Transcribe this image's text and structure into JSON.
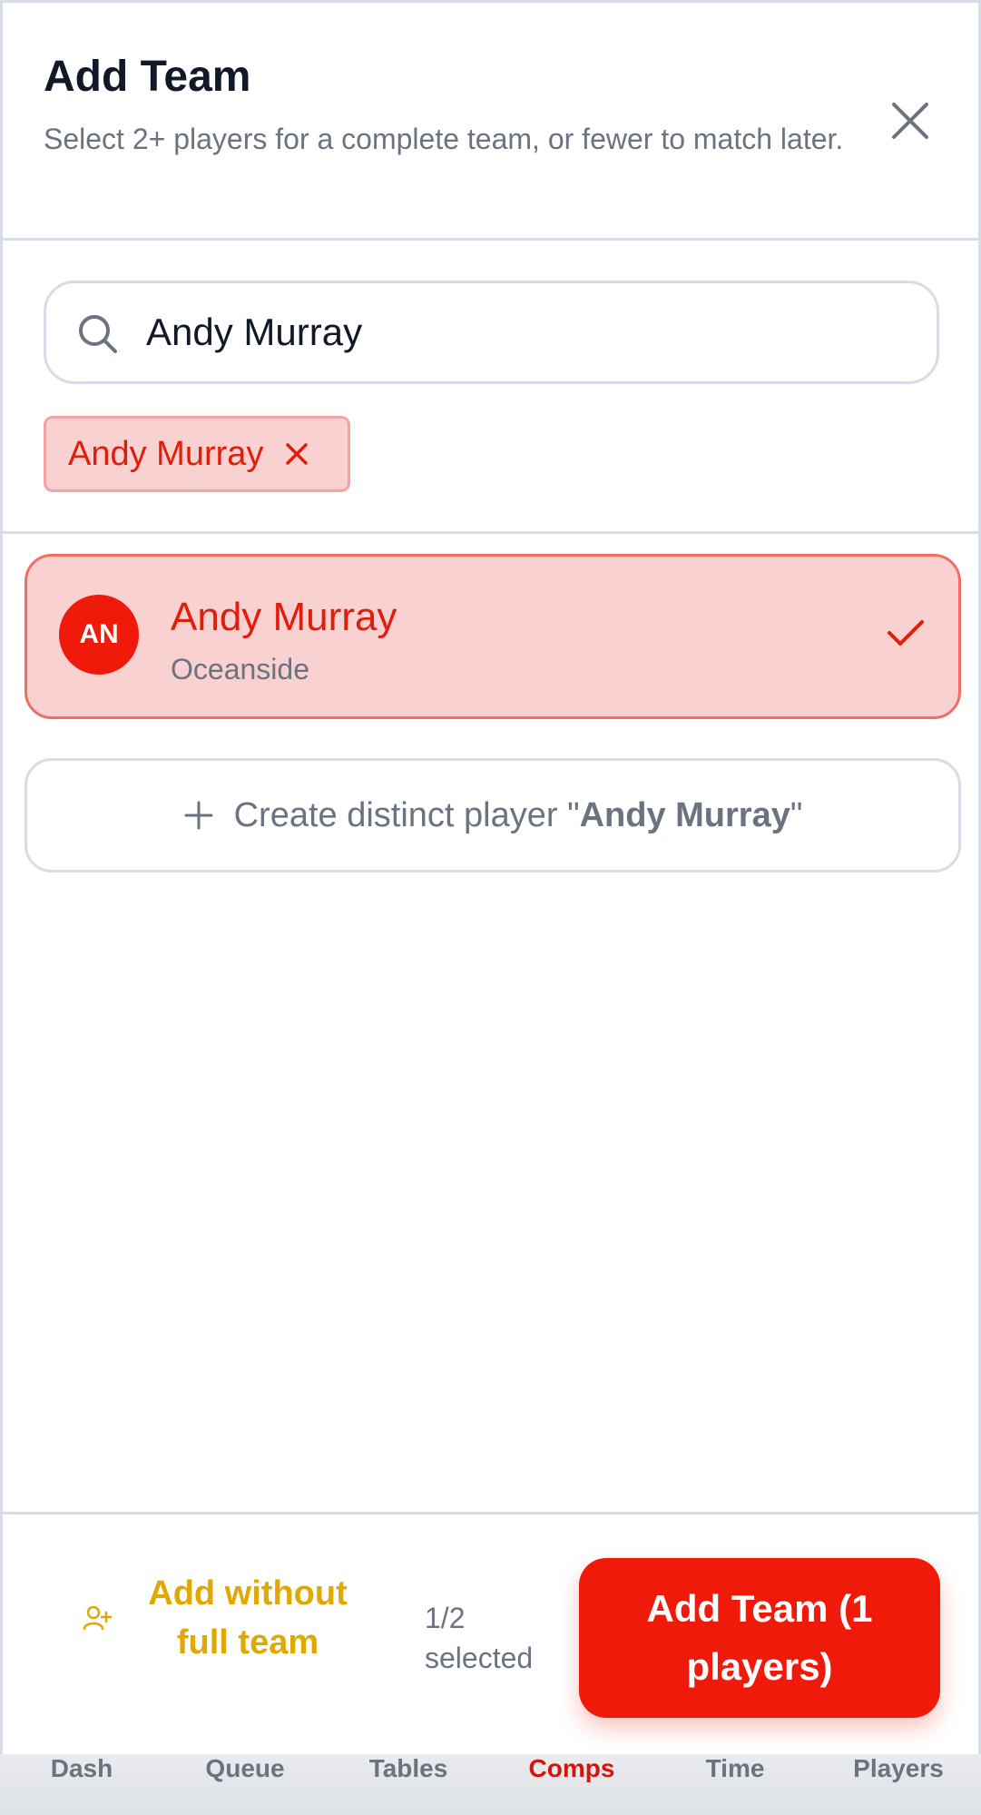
{
  "modal": {
    "title": "Add Team",
    "subtitle": "Select 2+ players for a complete team, or fewer to match later."
  },
  "search": {
    "value": "Andy Murray",
    "placeholder": ""
  },
  "selected_chips": [
    {
      "label": "Andy Murray"
    }
  ],
  "results": [
    {
      "initials": "AN",
      "name": "Andy Murray",
      "location": "Oceanside",
      "selected": true
    }
  ],
  "create": {
    "prefix": "Create distinct player \"",
    "name": "Andy Murray",
    "suffix": "\""
  },
  "footer": {
    "add_without_label": "Add without full team",
    "selected_count": "1/2 selected",
    "add_team_label": "Add Team (1 players)"
  },
  "nav": {
    "items": [
      "Dash",
      "Queue",
      "Tables",
      "Comps",
      "Time",
      "Players"
    ],
    "active": "Comps"
  },
  "colors": {
    "accent": "#ef1a0a",
    "accent_light": "#f9d1d0",
    "warning": "#e0a800",
    "muted": "#6b7280"
  },
  "icons": {
    "close": "close-icon",
    "search": "search-icon",
    "chip_remove": "x-icon",
    "check": "check-icon",
    "plus": "plus-icon",
    "add_user": "user-plus-icon"
  }
}
